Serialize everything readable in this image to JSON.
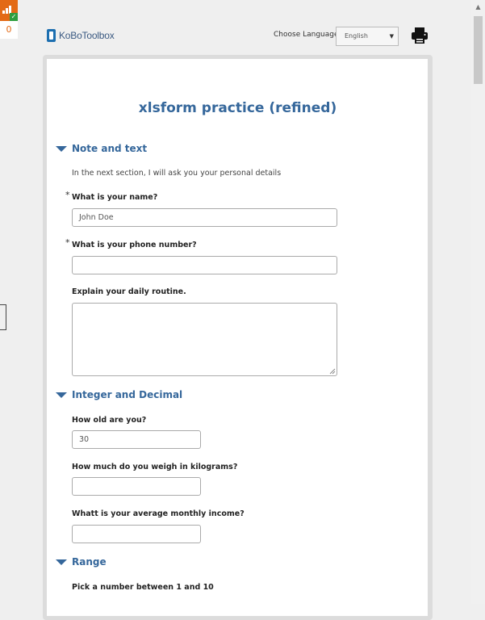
{
  "sidebar_badge": {
    "count": "0",
    "color": "#e36a16"
  },
  "header": {
    "logo_text": "KoBoToolbox",
    "language_label": "Choose Language",
    "language_selected": "English"
  },
  "form": {
    "title": "xlsform practice (refined)",
    "accent_color": "#35679b",
    "sections": [
      {
        "title": "Note and text",
        "note": "In the next section, I will ask you your personal details",
        "fields": [
          {
            "label": "What is your name?",
            "required": "*",
            "value": "John Doe"
          },
          {
            "label": "What is your phone number?",
            "required": "*",
            "value": ""
          },
          {
            "label": "Explain your daily routine.",
            "value": ""
          }
        ]
      },
      {
        "title": "Integer and Decimal",
        "fields": [
          {
            "label": "How old are you?",
            "value": "30"
          },
          {
            "label": "How much do you weigh in kilograms?",
            "value": ""
          },
          {
            "label": "Whatt is your average monthly income?",
            "value": ""
          }
        ]
      },
      {
        "title": "Range",
        "fields": [
          {
            "label": "Pick a number between 1 and 10"
          }
        ]
      }
    ]
  }
}
